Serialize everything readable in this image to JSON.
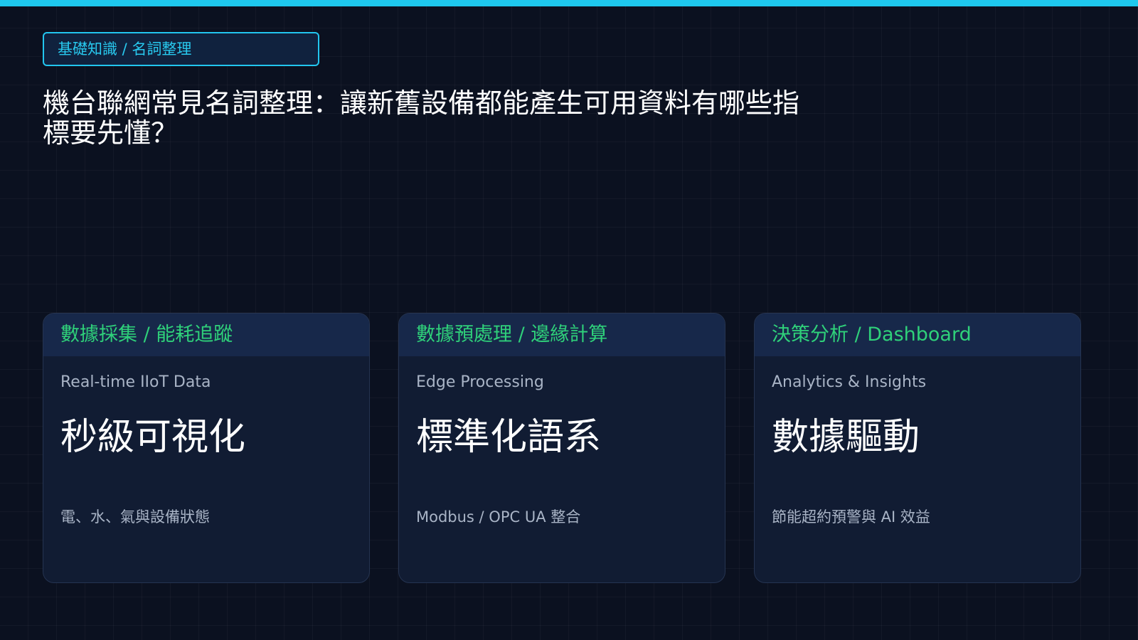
{
  "tag": "基礎知識 / 名詞整理",
  "title_line1": "機台聯網常見名詞整理：讓新舊設備都能產生可用資料有哪些指",
  "title_line2": "標要先懂？",
  "cards": [
    {
      "header": "數據採集 / 能耗追蹤",
      "subtitle": "Real-time IIoT Data",
      "headline": "秒級可視化",
      "note": "電、水、氣與設備狀態"
    },
    {
      "header": "數據預處理 / 邊緣計算",
      "subtitle": "Edge Processing",
      "headline": "標準化語系",
      "note": "Modbus / OPC UA 整合"
    },
    {
      "header": "決策分析 / Dashboard",
      "subtitle": "Analytics & Insights",
      "headline": "數據驅動",
      "note": "節能超約預警與 AI 效益"
    }
  ],
  "colors": {
    "background": "#0b1120",
    "accent": "#1ec8ee",
    "card_header_text": "#2fd17a",
    "card_bg": "#111c33"
  }
}
